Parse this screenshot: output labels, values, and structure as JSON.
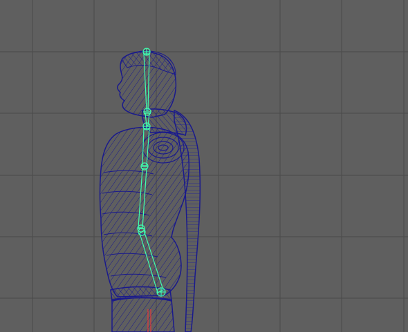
{
  "viewport": {
    "background_color": "#5f5f5f",
    "grid_color": "#4a4a4a",
    "mesh_color": "#1a1a8c",
    "skeleton_color": "#40ffb0",
    "pivot_color": "#ff3030"
  },
  "scene": {
    "object": "character-wireframe-mesh",
    "skeleton": "spine-joint-chain",
    "joint_count": 7
  }
}
